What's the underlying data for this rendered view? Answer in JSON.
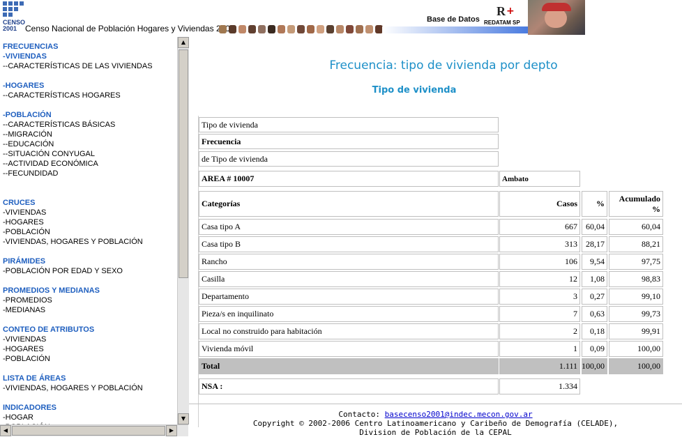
{
  "header": {
    "logo_line1": "CENSO",
    "logo_line2": "2001",
    "title": "Censo Nacional de Población Hogares y Viviendas 2001",
    "db_label": "Base de Datos",
    "redatam_text": "REDATAM SP"
  },
  "sidebar": {
    "items": [
      {
        "label": "FRECUENCIAS",
        "kind": "section"
      },
      {
        "label": "-VIVIENDAS",
        "kind": "section"
      },
      {
        "label": "--CARACTERÍSTICAS DE LAS VIVIENDAS",
        "kind": "link"
      },
      {
        "label": "-HOGARES",
        "kind": "section"
      },
      {
        "label": "--CARACTERÍSTICAS HOGARES",
        "kind": "link"
      },
      {
        "label": "-POBLACIÓN",
        "kind": "section"
      },
      {
        "label": "--CARACTERÍSTICAS BÁSICAS",
        "kind": "link"
      },
      {
        "label": "--MIGRACIÓN",
        "kind": "link"
      },
      {
        "label": "--EDUCACIÓN",
        "kind": "link"
      },
      {
        "label": "--SITUACIÓN CONYUGAL",
        "kind": "link"
      },
      {
        "label": "--ACTIVIDAD ECONÓMICA",
        "kind": "link"
      },
      {
        "label": "--FECUNDIDAD",
        "kind": "link"
      },
      {
        "label": "CRUCES",
        "kind": "section"
      },
      {
        "label": "-VIVIENDAS",
        "kind": "link"
      },
      {
        "label": "-HOGARES",
        "kind": "link"
      },
      {
        "label": "-POBLACIÓN",
        "kind": "link"
      },
      {
        "label": "-VIVIENDAS, HOGARES Y POBLACIÓN",
        "kind": "link"
      },
      {
        "label": "PIRÁMIDES",
        "kind": "section"
      },
      {
        "label": "-POBLACIÓN POR EDAD Y SEXO",
        "kind": "link"
      },
      {
        "label": "PROMEDIOS Y MEDIANAS",
        "kind": "section"
      },
      {
        "label": "-PROMEDIOS",
        "kind": "link"
      },
      {
        "label": "-MEDIANAS",
        "kind": "link"
      },
      {
        "label": "CONTEO DE ATRIBUTOS",
        "kind": "section"
      },
      {
        "label": "-VIVIENDAS",
        "kind": "link"
      },
      {
        "label": "-HOGARES",
        "kind": "link"
      },
      {
        "label": "-POBLACIÓN",
        "kind": "link"
      },
      {
        "label": "LISTA DE ÁREAS",
        "kind": "section"
      },
      {
        "label": "-VIVIENDAS, HOGARES Y POBLACIÓN",
        "kind": "link"
      },
      {
        "label": "INDICADORES",
        "kind": "section"
      },
      {
        "label": "-HOGAR",
        "kind": "link"
      },
      {
        "label": "-POBLACIÓN",
        "kind": "link"
      }
    ]
  },
  "main": {
    "title": "Frecuencia: tipo de vivienda por depto",
    "subtitle": "Tipo de vivienda",
    "meta": {
      "line1": "Tipo de vivienda",
      "line2": "Frecuencia",
      "line3": "de Tipo de vivienda"
    },
    "area": {
      "label": "AREA # 10007",
      "name": "Ambato"
    },
    "table": {
      "headers": {
        "categories": "Categorías",
        "cases": "Casos",
        "pct": "%",
        "cum1": "Acumulado",
        "cum2": "%"
      },
      "rows": [
        {
          "cat": "Casa tipo A",
          "cases": "667",
          "pct": "60,04",
          "cum": "60,04"
        },
        {
          "cat": "Casa tipo B",
          "cases": "313",
          "pct": "28,17",
          "cum": "88,21"
        },
        {
          "cat": "Rancho",
          "cases": "106",
          "pct": "9,54",
          "cum": "97,75"
        },
        {
          "cat": "Casilla",
          "cases": "12",
          "pct": "1,08",
          "cum": "98,83"
        },
        {
          "cat": "Departamento",
          "cases": "3",
          "pct": "0,27",
          "cum": "99,10"
        },
        {
          "cat": "Pieza/s en inquilinato",
          "cases": "7",
          "pct": "0,63",
          "cum": "99,73"
        },
        {
          "cat": "Local no construido para habitación",
          "cases": "2",
          "pct": "0,18",
          "cum": "99,91"
        },
        {
          "cat": "Vivienda móvil",
          "cases": "1",
          "pct": "0,09",
          "cum": "100,00"
        }
      ],
      "total": {
        "label": "Total",
        "cases": "1.111",
        "pct": "100,00",
        "cum": "100,00"
      },
      "nsa": {
        "label": "NSA :",
        "value": "1.334"
      }
    }
  },
  "footer": {
    "contact_label": "Contacto:",
    "contact_email": "basecenso2001@indec.mecon.gov.ar",
    "copyright": "Copyright © 2002-2006 Centro Latinoamericano y Caribeño de Demografía (CELADE),",
    "division": "Division de Población de la CEPAL"
  },
  "colors": {
    "section_blue": "#1f5fbf",
    "title_blue": "#1e90c8",
    "total_gray": "#c0c0c0"
  }
}
